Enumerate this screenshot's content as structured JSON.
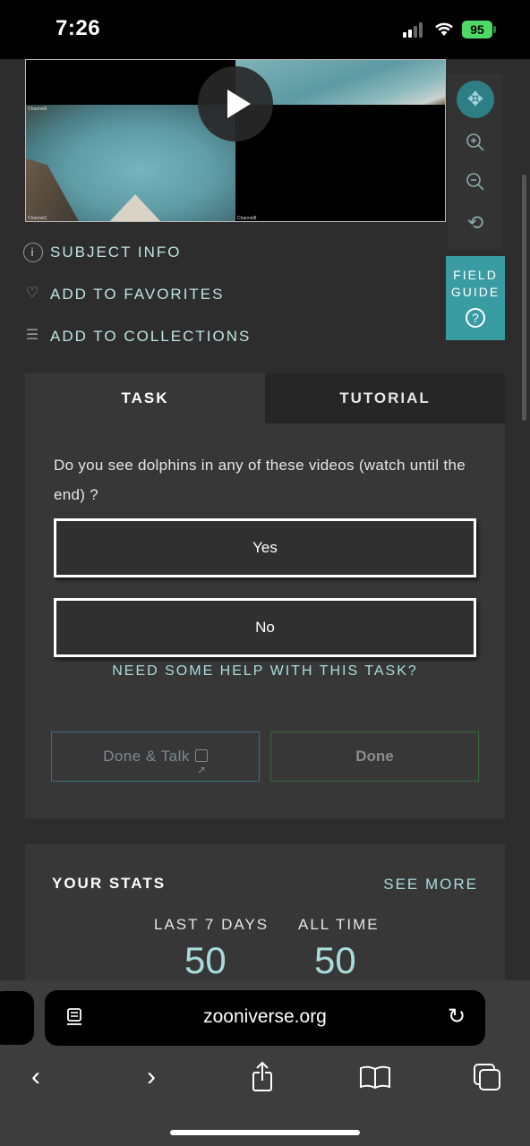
{
  "status_bar": {
    "time": "7:26",
    "battery": "95"
  },
  "video": {
    "channel_labels": [
      "Channel6",
      "Channel1",
      "Channel8"
    ]
  },
  "toolbar": {
    "field_guide_line1": "FIELD",
    "field_guide_line2": "GUIDE",
    "field_guide_q": "?"
  },
  "meta_links": {
    "subject_info": "SUBJECT INFO",
    "add_favorites": "ADD TO FAVORITES",
    "add_collections": "ADD TO COLLECTIONS"
  },
  "task": {
    "tabs": [
      "TASK",
      "TUTORIAL"
    ],
    "question": "Do you see dolphins in any of these videos (watch until the end) ?",
    "answers": [
      "Yes",
      "No"
    ],
    "help_link": "NEED SOME HELP WITH THIS TASK?",
    "done_talk": "Done & Talk",
    "done": "Done"
  },
  "stats": {
    "title": "YOUR STATS",
    "see_more": "SEE MORE",
    "last7_label": "LAST 7 DAYS",
    "last7_value": "50",
    "alltime_label": "ALL TIME",
    "alltime_value": "50"
  },
  "browser": {
    "url": "zooniverse.org"
  },
  "colors": {
    "accent": "#3a9ca3",
    "link": "#a8dcdc",
    "background": "#2d2d2d"
  },
  "icons": [
    "move-icon",
    "zoom-in-icon",
    "zoom-out-icon",
    "rotate-icon",
    "info-icon",
    "heart-icon",
    "list-icon",
    "external-link-icon",
    "reader-icon",
    "reload-icon",
    "back-icon",
    "forward-icon",
    "share-icon",
    "bookmarks-icon",
    "tabs-icon"
  ]
}
